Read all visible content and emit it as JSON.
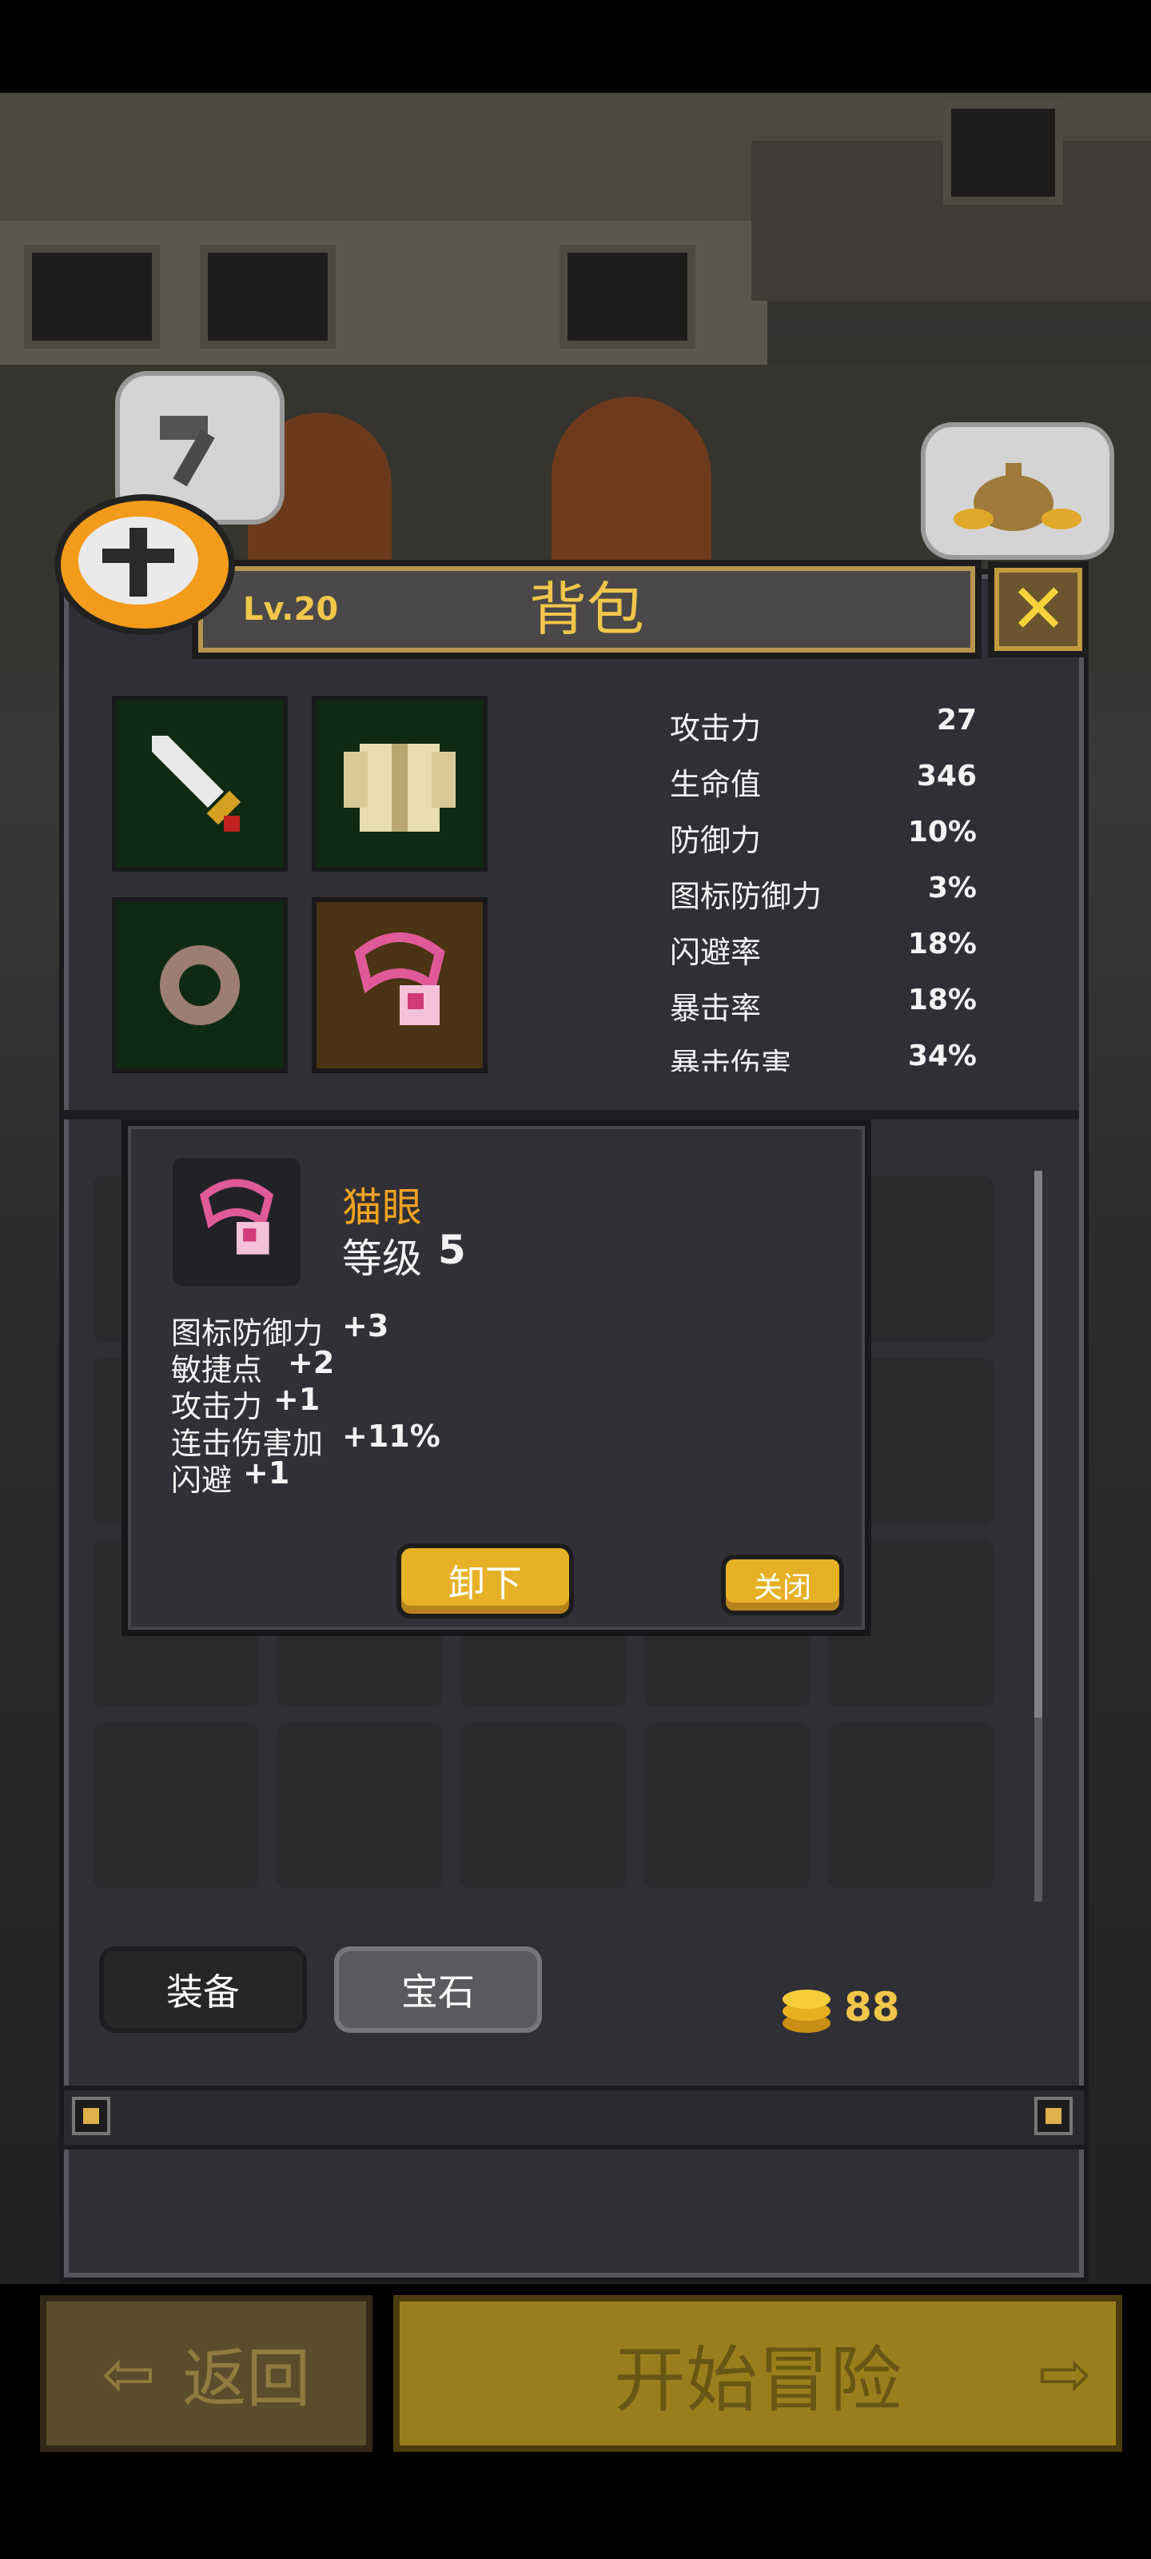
{
  "header": {
    "level": "Lv.20",
    "title": "背包",
    "close_symbol": "✕"
  },
  "equipment": [
    {
      "name": "sword",
      "icon": "sword-icon"
    },
    {
      "name": "armor",
      "icon": "armor-icon"
    },
    {
      "name": "ring",
      "icon": "ring-icon"
    },
    {
      "name": "amulet",
      "icon": "cat-eye-amulet-icon"
    }
  ],
  "stats": [
    {
      "label": "攻击力",
      "value": "27"
    },
    {
      "label": "生命值",
      "value": "346"
    },
    {
      "label": "防御力",
      "value": "10%"
    },
    {
      "label": "图标防御力",
      "value": "3%"
    },
    {
      "label": "闪避率",
      "value": "18%"
    },
    {
      "label": "暴击率",
      "value": "18%"
    },
    {
      "label": "暴击伤害",
      "value": "34%"
    }
  ],
  "popup": {
    "item_name": "猫眼",
    "level_label": "等级",
    "level_value": "5",
    "attributes": [
      {
        "label": "图标防御力",
        "value": "+3"
      },
      {
        "label": "敏捷点",
        "value": "+2"
      },
      {
        "label": "攻击力",
        "value": "+1"
      },
      {
        "label": "连击伤害加",
        "value": "+11%"
      },
      {
        "label": "闪避",
        "value": "+1"
      }
    ],
    "unequip_label": "卸下",
    "close_label": "关闭"
  },
  "tabs": {
    "equipment": "装备",
    "gems": "宝石"
  },
  "gold": "88",
  "footer": {
    "back_label": "返回",
    "start_label": "开始冒险"
  },
  "colors": {
    "accent_gold": "#f1c64a",
    "item_name": "#f2a221",
    "panel": "#2f2f36"
  }
}
